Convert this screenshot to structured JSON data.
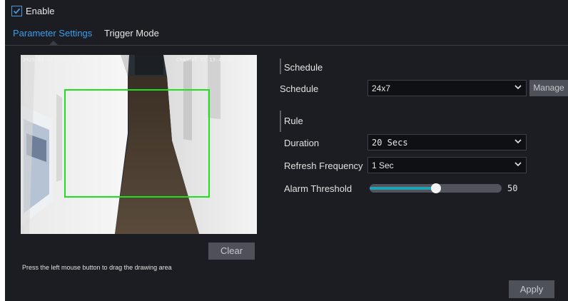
{
  "enable": {
    "label": "Enable",
    "checked": true
  },
  "tabs": [
    {
      "label": "Parameter Settings",
      "active": true
    },
    {
      "label": "Trigger Mode",
      "active": false
    }
  ],
  "preview": {
    "osd_left": "2025-01-01 (Tue) 13:45",
    "osd_right": "Channel 01  13:45:00",
    "clear_label": "Clear",
    "hint": "Press the left mouse button to drag the drawing area"
  },
  "schedule_section": {
    "title": "Schedule",
    "label": "Schedule",
    "value": "24x7",
    "manage_label": "Manage"
  },
  "rule_section": {
    "title": "Rule",
    "duration_label": "Duration",
    "duration_value": "20 Secs",
    "refresh_label": "Refresh Frequency",
    "refresh_value": "1 Sec",
    "threshold_label": "Alarm Threshold",
    "threshold_value": "50"
  },
  "apply_label": "Apply",
  "colors": {
    "accent": "#3d9ee8",
    "detection_box": "#1ee01e",
    "slider_fill": "#1fa2b3"
  }
}
